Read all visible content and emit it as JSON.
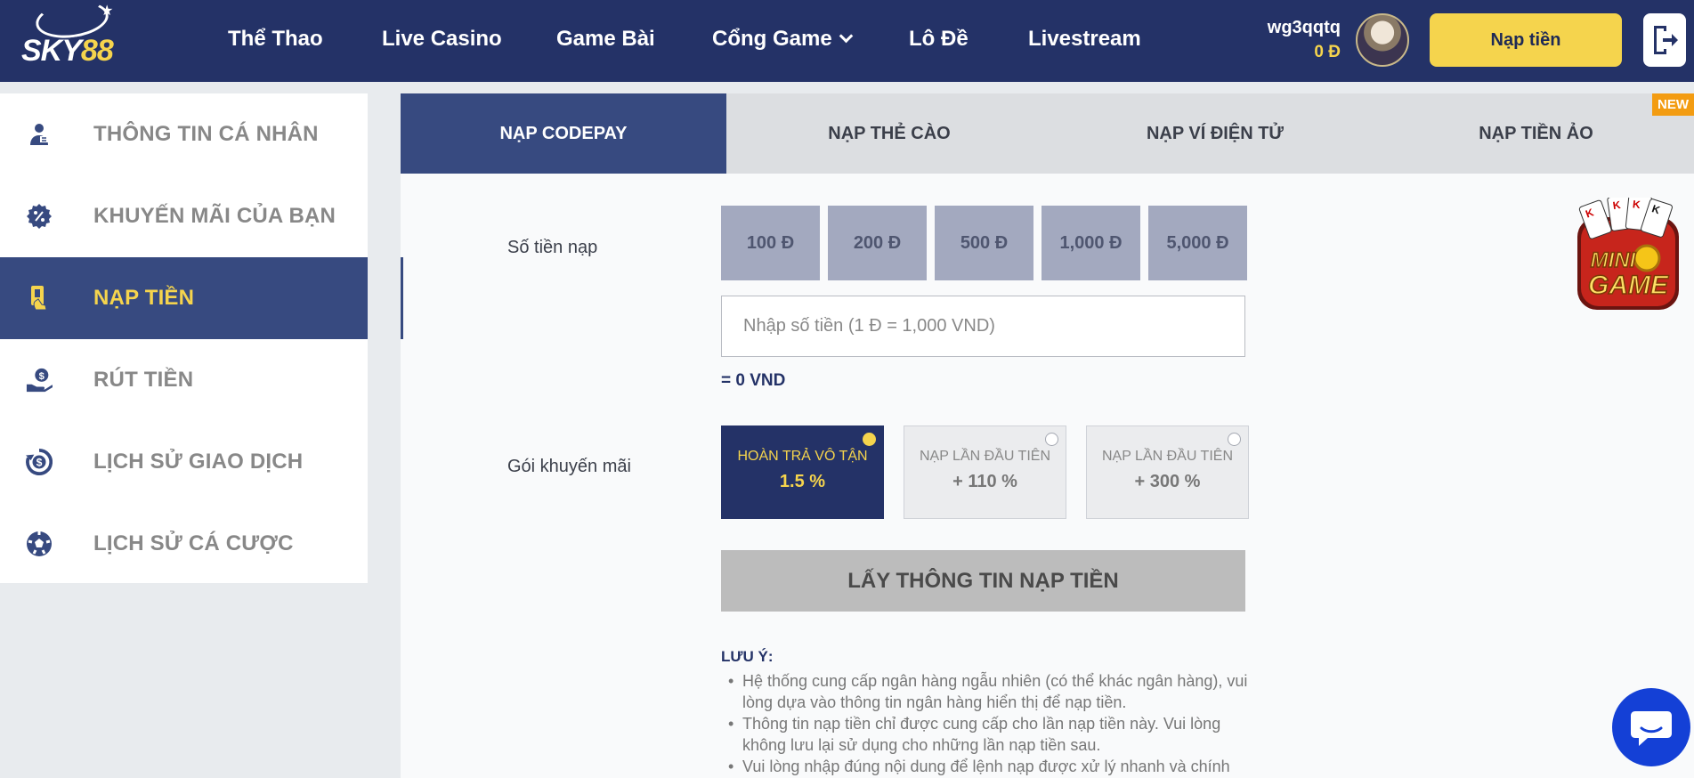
{
  "header": {
    "logo_text": "SKY",
    "logo_number": "88",
    "nav": [
      "Thể Thao",
      "Live Casino",
      "Game Bài",
      "Cổng Game",
      "Lô Đề",
      "Livestream"
    ],
    "username": "wg3qqtq",
    "balance": "0 Đ",
    "deposit_button": "Nạp tiền"
  },
  "sidebar": {
    "items": [
      {
        "label": "THÔNG TIN CÁ NHÂN",
        "icon": "user-icon",
        "active": false
      },
      {
        "label": "KHUYẾN MÃI CỦA BẠN",
        "icon": "promo-percent-icon",
        "active": false
      },
      {
        "label": "NẠP TIỀN",
        "icon": "deposit-card-icon",
        "active": true
      },
      {
        "label": "RÚT TIỀN",
        "icon": "withdraw-money-icon",
        "active": false
      },
      {
        "label": "LỊCH SỬ GIAO DỊCH",
        "icon": "transaction-history-icon",
        "active": false
      },
      {
        "label": "LỊCH SỬ CÁ CƯỢC",
        "icon": "soccer-ball-icon",
        "active": false
      }
    ]
  },
  "tabs": [
    {
      "label": "NẠP CODEPAY",
      "active": true
    },
    {
      "label": "NẠP THẺ CÀO",
      "active": false
    },
    {
      "label": "NẠP VÍ ĐIỆN TỬ",
      "active": false
    },
    {
      "label": "NẠP TIỀN ẢO",
      "active": false,
      "badge": "NEW"
    }
  ],
  "form": {
    "amount_label": "Số tiền nạp",
    "amount_options": [
      "100 Đ",
      "200 Đ",
      "500 Đ",
      "1,000 Đ",
      "5,000 Đ"
    ],
    "amount_placeholder": "Nhập số tiền (1 Đ = 1,000 VND)",
    "vnd_result": "= 0 VND",
    "promo_label": "Gói khuyến mãi",
    "promos": [
      {
        "title": "HOÀN TRẢ VÔ TẬN",
        "value": "1.5 %",
        "selected": true
      },
      {
        "title": "NẠP LẦN ĐẦU TIÊN",
        "value": "+ 110 %",
        "selected": false
      },
      {
        "title": "NẠP LẦN ĐẦU TIÊN",
        "value": "+ 300 %",
        "selected": false
      }
    ],
    "submit_button": "LẤY THÔNG TIN NẠP TIỀN"
  },
  "notes": {
    "title": "LƯU Ý:",
    "items": [
      "Hệ thống cung cấp ngân hàng ngẫu nhiên (có thể khác ngân hàng), vui lòng dựa vào thông tin ngân hàng hiển thị để nạp tiền.",
      "Thông tin nạp tiền chỉ được cung cấp cho lần nạp tiền này. Vui lòng không lưu lại sử dụng cho những lần nạp tiền sau.",
      "Vui lòng nhập đúng nội dung để lệnh nạp được xử lý nhanh và chính"
    ]
  },
  "minigame": {
    "line1": "MINI",
    "line2": "GAME"
  },
  "colors": {
    "brand": "#243267",
    "accent": "#f5d44d",
    "active_bg": "#374a80",
    "badge": "#f39c12",
    "chat": "#1440d6"
  }
}
